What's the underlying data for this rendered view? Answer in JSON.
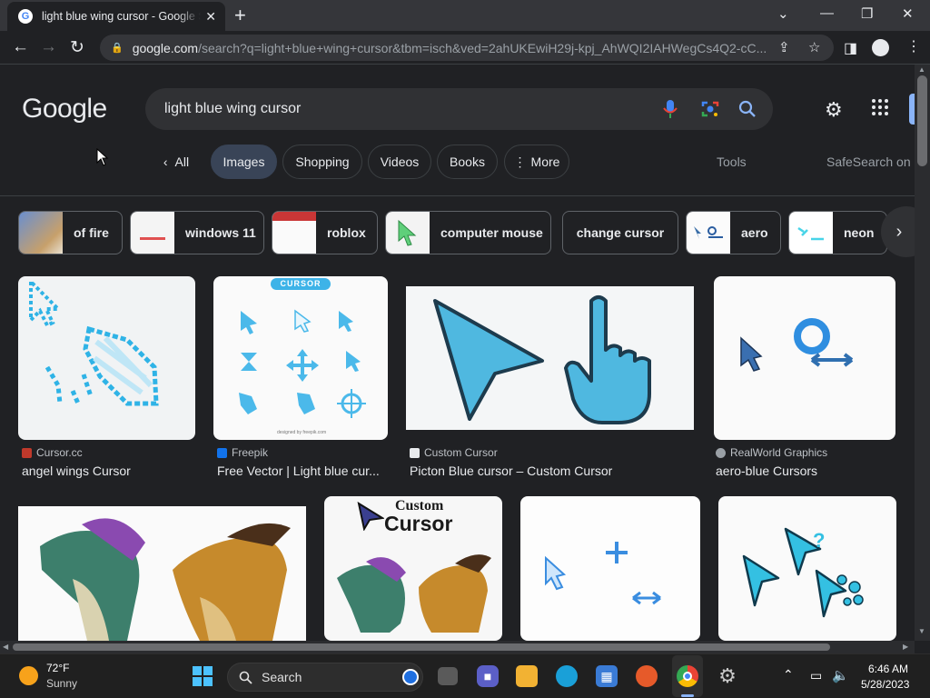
{
  "browser": {
    "tab_title": "light blue wing cursor - Google S",
    "url_main": "google.com",
    "url_rest": "/search?q=light+blue+wing+cursor&tbm=isch&ved=2ahUKEwiH29j-kpj_AhWQI2IAHWegCs4Q2-cC...",
    "icons": [
      "google-favicon",
      "close-icon",
      "plus-icon",
      "chevron-down-icon",
      "minimize-icon",
      "restore-icon",
      "back-icon",
      "forward-icon",
      "reload-icon",
      "lock-icon",
      "share-icon",
      "star-icon",
      "sidepanel-icon",
      "profile-icon",
      "kebab-icon"
    ]
  },
  "google": {
    "logo": "Google",
    "query": "light blue wing cursor",
    "filters": [
      "All",
      "Images",
      "Shopping",
      "Videos",
      "Books",
      "More"
    ],
    "active_filter": "Images",
    "tools": "Tools",
    "safesearch": "SafeSearch on"
  },
  "refinements": [
    "of fire",
    "windows 11",
    "roblox",
    "computer mouse",
    "change cursor",
    "aero",
    "neon"
  ],
  "results_row1": [
    {
      "source": "Cursor.cc",
      "title": "angel wings Cursor"
    },
    {
      "source": "Freepik",
      "title": "Free Vector | Light blue cur..."
    },
    {
      "source": "Custom Cursor",
      "title": "Picton Blue cursor – Custom Cursor"
    },
    {
      "source": "RealWorld Graphics",
      "title": "aero-blue Cursors"
    }
  ],
  "image_text": {
    "freepik_banner": "CURSOR",
    "custom_cursor_logo_1": "Custom",
    "custom_cursor_logo_2": "Cursor"
  },
  "taskbar": {
    "temp": "72°F",
    "weather": "Sunny",
    "search": "Search",
    "time": "6:46 AM",
    "date": "5/28/2023"
  },
  "colors": {
    "page_bg": "#202124",
    "chip_active": "#394457",
    "cursor_blue": "#4fb8e0",
    "accent": "#8ab4f8"
  }
}
